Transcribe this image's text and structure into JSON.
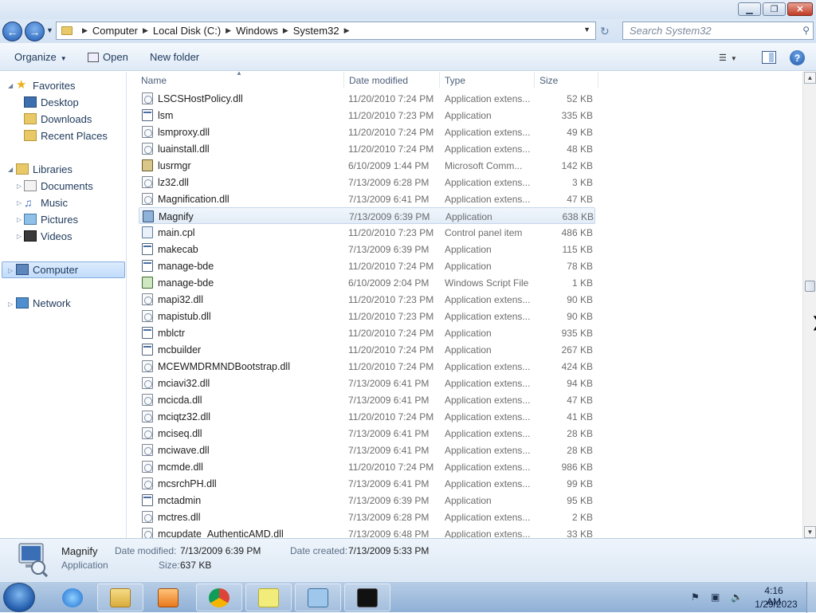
{
  "window": {
    "minimize_icon": "▁",
    "maximize_icon": "❐",
    "close_icon": "✕"
  },
  "address": {
    "crumbs": [
      "Computer",
      "Local Disk (C:)",
      "Windows",
      "System32"
    ],
    "search_placeholder": "Search System32"
  },
  "toolbar": {
    "organize_label": "Organize",
    "open_label": "Open",
    "new_folder_label": "New folder",
    "help_label": "?"
  },
  "nav": {
    "favorites": "Favorites",
    "desktop": "Desktop",
    "downloads": "Downloads",
    "recent_places": "Recent Places",
    "libraries": "Libraries",
    "documents": "Documents",
    "music": "Music",
    "pictures": "Pictures",
    "videos": "Videos",
    "computer": "Computer",
    "network": "Network"
  },
  "columns": {
    "name": "Name",
    "date_modified": "Date modified",
    "type": "Type",
    "size": "Size"
  },
  "files": [
    {
      "name": "LSCSHostPolicy.dll",
      "date": "11/20/2010 7:24 PM",
      "type": "Application extens...",
      "size": "52 KB",
      "icon": "dll"
    },
    {
      "name": "lsm",
      "date": "11/20/2010 7:23 PM",
      "type": "Application",
      "size": "335 KB",
      "icon": "app"
    },
    {
      "name": "lsmproxy.dll",
      "date": "11/20/2010 7:24 PM",
      "type": "Application extens...",
      "size": "49 KB",
      "icon": "dll"
    },
    {
      "name": "luainstall.dll",
      "date": "11/20/2010 7:24 PM",
      "type": "Application extens...",
      "size": "48 KB",
      "icon": "dll"
    },
    {
      "name": "lusrmgr",
      "date": "6/10/2009 1:44 PM",
      "type": "Microsoft Comm...",
      "size": "142 KB",
      "icon": "msc"
    },
    {
      "name": "lz32.dll",
      "date": "7/13/2009 6:28 PM",
      "type": "Application extens...",
      "size": "3 KB",
      "icon": "dll"
    },
    {
      "name": "Magnification.dll",
      "date": "7/13/2009 6:41 PM",
      "type": "Application extens...",
      "size": "47 KB",
      "icon": "dll"
    },
    {
      "name": "Magnify",
      "date": "7/13/2009 6:39 PM",
      "type": "Application",
      "size": "638 KB",
      "icon": "magnify",
      "selected": true
    },
    {
      "name": "main.cpl",
      "date": "11/20/2010 7:23 PM",
      "type": "Control panel item",
      "size": "486 KB",
      "icon": "cpl"
    },
    {
      "name": "makecab",
      "date": "7/13/2009 6:39 PM",
      "type": "Application",
      "size": "115 KB",
      "icon": "app"
    },
    {
      "name": "manage-bde",
      "date": "11/20/2010 7:24 PM",
      "type": "Application",
      "size": "78 KB",
      "icon": "app"
    },
    {
      "name": "manage-bde",
      "date": "6/10/2009 2:04 PM",
      "type": "Windows Script File",
      "size": "1 KB",
      "icon": "wsf"
    },
    {
      "name": "mapi32.dll",
      "date": "11/20/2010 7:23 PM",
      "type": "Application extens...",
      "size": "90 KB",
      "icon": "dll"
    },
    {
      "name": "mapistub.dll",
      "date": "11/20/2010 7:23 PM",
      "type": "Application extens...",
      "size": "90 KB",
      "icon": "dll"
    },
    {
      "name": "mblctr",
      "date": "11/20/2010 7:24 PM",
      "type": "Application",
      "size": "935 KB",
      "icon": "app"
    },
    {
      "name": "mcbuilder",
      "date": "11/20/2010 7:24 PM",
      "type": "Application",
      "size": "267 KB",
      "icon": "app"
    },
    {
      "name": "MCEWMDRMNDBootstrap.dll",
      "date": "11/20/2010 7:24 PM",
      "type": "Application extens...",
      "size": "424 KB",
      "icon": "dll"
    },
    {
      "name": "mciavi32.dll",
      "date": "7/13/2009 6:41 PM",
      "type": "Application extens...",
      "size": "94 KB",
      "icon": "dll"
    },
    {
      "name": "mcicda.dll",
      "date": "7/13/2009 6:41 PM",
      "type": "Application extens...",
      "size": "47 KB",
      "icon": "dll"
    },
    {
      "name": "mciqtz32.dll",
      "date": "11/20/2010 7:24 PM",
      "type": "Application extens...",
      "size": "41 KB",
      "icon": "dll"
    },
    {
      "name": "mciseq.dll",
      "date": "7/13/2009 6:41 PM",
      "type": "Application extens...",
      "size": "28 KB",
      "icon": "dll"
    },
    {
      "name": "mciwave.dll",
      "date": "7/13/2009 6:41 PM",
      "type": "Application extens...",
      "size": "28 KB",
      "icon": "dll"
    },
    {
      "name": "mcmde.dll",
      "date": "11/20/2010 7:24 PM",
      "type": "Application extens...",
      "size": "986 KB",
      "icon": "dll"
    },
    {
      "name": "mcsrchPH.dll",
      "date": "7/13/2009 6:41 PM",
      "type": "Application extens...",
      "size": "99 KB",
      "icon": "dll"
    },
    {
      "name": "mctadmin",
      "date": "7/13/2009 6:39 PM",
      "type": "Application",
      "size": "95 KB",
      "icon": "app"
    },
    {
      "name": "mctres.dll",
      "date": "7/13/2009 6:28 PM",
      "type": "Application extens...",
      "size": "2 KB",
      "icon": "dll"
    },
    {
      "name": "mcupdate_AuthenticAMD.dll",
      "date": "7/13/2009 6:48 PM",
      "type": "Application extens...",
      "size": "33 KB",
      "icon": "dll"
    }
  ],
  "details": {
    "name": "Magnify",
    "kind": "Application",
    "date_modified_label": "Date modified:",
    "date_modified": "7/13/2009 6:39 PM",
    "size_label": "Size:",
    "size": "637 KB",
    "date_created_label": "Date created:",
    "date_created": "7/13/2009 5:33 PM"
  },
  "taskbar": {
    "time": "4:16 AM",
    "date": "1/29/2023"
  }
}
